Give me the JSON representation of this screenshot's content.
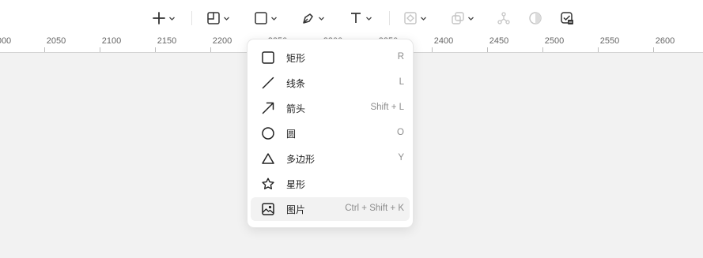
{
  "toolbar": {
    "tools": [
      {
        "name": "insert",
        "icon": "plus-icon"
      },
      {
        "name": "frame",
        "icon": "frame-icon"
      },
      {
        "name": "shape",
        "icon": "rectangle-icon"
      },
      {
        "name": "pen",
        "icon": "pen-icon"
      },
      {
        "name": "text",
        "icon": "text-icon"
      },
      {
        "name": "component",
        "icon": "component-icon",
        "disabled": true
      },
      {
        "name": "boolean",
        "icon": "boolean-icon",
        "disabled": true
      },
      {
        "name": "vector-network",
        "icon": "vector-network-icon",
        "disabled": true
      },
      {
        "name": "mask",
        "icon": "mask-icon",
        "disabled": true
      },
      {
        "name": "check-export",
        "icon": "check-export-icon"
      }
    ]
  },
  "ruler": {
    "ticks": [
      "000",
      "2050",
      "2100",
      "2150",
      "2200",
      "2250",
      "2300",
      "2350",
      "2400",
      "2450",
      "2500",
      "2550",
      "2600"
    ]
  },
  "shape_menu": {
    "items": [
      {
        "label": "矩形",
        "shortcut": "R",
        "icon": "rectangle-icon"
      },
      {
        "label": "线条",
        "shortcut": "L",
        "icon": "line-icon"
      },
      {
        "label": "箭头",
        "shortcut": "Shift + L",
        "icon": "arrow-icon"
      },
      {
        "label": "圆",
        "shortcut": "O",
        "icon": "circle-icon"
      },
      {
        "label": "多边形",
        "shortcut": "Y",
        "icon": "triangle-icon"
      },
      {
        "label": "星形",
        "shortcut": "",
        "icon": "star-icon"
      },
      {
        "label": "图片",
        "shortcut": "Ctrl + Shift + K",
        "icon": "image-icon",
        "highlighted": true
      }
    ]
  },
  "colors": {
    "toolbar_bg": "#ffffff",
    "canvas_bg": "#f2f2f2",
    "icon_dark": "#333333",
    "icon_disabled": "#c4c4c4",
    "highlight": "#f2f2f2"
  }
}
